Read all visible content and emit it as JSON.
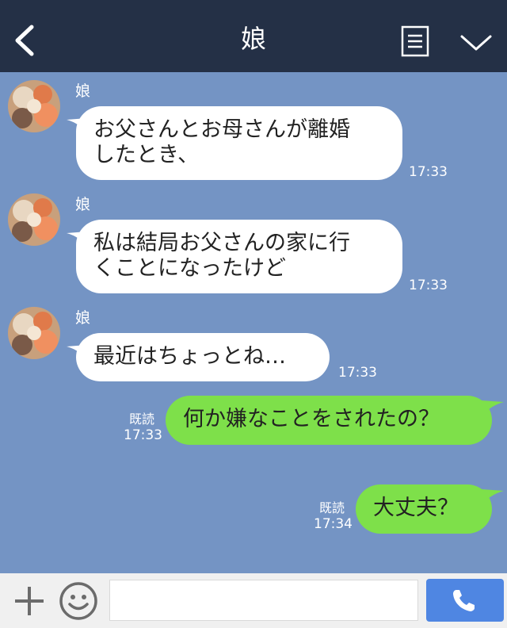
{
  "header": {
    "title": "娘",
    "back_icon": "chevron-left-icon",
    "menu_icon": "menu-list-icon",
    "collapse_icon": "chevron-down-icon"
  },
  "messages": [
    {
      "direction": "in",
      "sender": "娘",
      "lines": [
        "お父さんとお母さんが離婚",
        "したとき、"
      ],
      "time": "17:33"
    },
    {
      "direction": "in",
      "sender": "娘",
      "lines": [
        "私は結局お父さんの家に行",
        "くことになったけど"
      ],
      "time": "17:33"
    },
    {
      "direction": "in",
      "sender": "娘",
      "lines": [
        "最近はちょっとね…"
      ],
      "time": "17:33"
    },
    {
      "direction": "out",
      "read": "既読",
      "lines": [
        "何か嫌なことをされたの？"
      ],
      "time": "17:33"
    },
    {
      "direction": "out",
      "read": "既読",
      "lines": [
        "大丈夫？"
      ],
      "time": "17:34"
    }
  ],
  "footer": {
    "plus_icon": "plus-icon",
    "emoji_icon": "smiley-icon",
    "input_value": "",
    "call_icon": "phone-icon"
  },
  "colors": {
    "header_bg": "#243046",
    "chat_bg": "#7494c4",
    "incoming_bubble": "#ffffff",
    "outgoing_bubble": "#7ee04a",
    "call_button": "#4f86e2"
  }
}
